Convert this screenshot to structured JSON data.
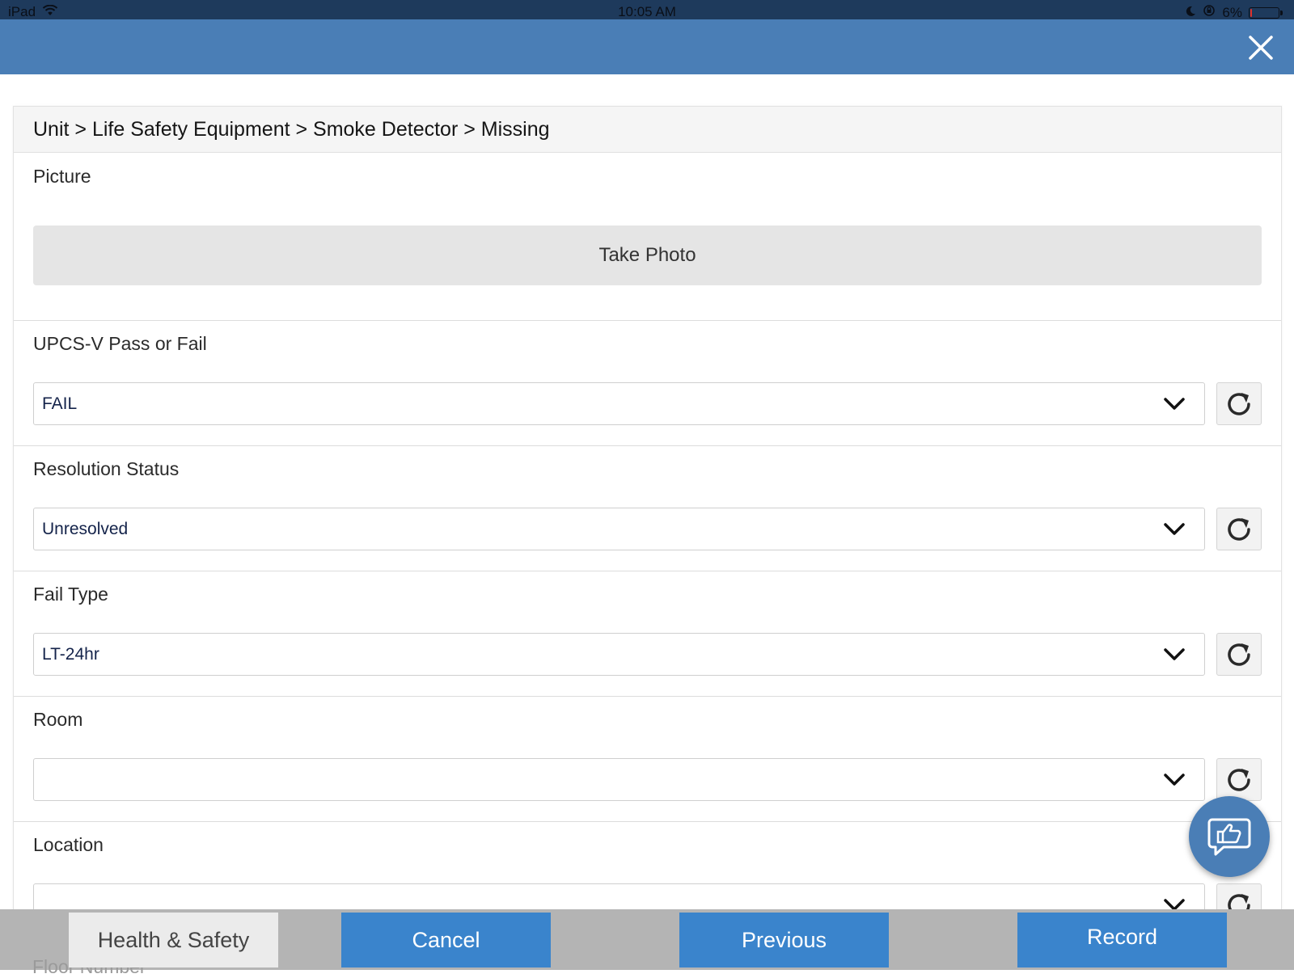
{
  "status_bar": {
    "device": "iPad",
    "time": "10:05 AM",
    "battery_percent": "6%",
    "battery_level": 0.06
  },
  "breadcrumb": "Unit > Life Safety Equipment > Smoke Detector > Missing",
  "picture": {
    "label": "Picture",
    "button_label": "Take Photo"
  },
  "fields": [
    {
      "label": "UPCS-V Pass or Fail",
      "value": "FAIL"
    },
    {
      "label": "Resolution Status",
      "value": "Unresolved"
    },
    {
      "label": "Fail Type",
      "value": "LT-24hr"
    },
    {
      "label": "Room",
      "value": ""
    },
    {
      "label": "Location",
      "value": ""
    }
  ],
  "partially_hidden_label": "Floor Number",
  "footer": {
    "health_safety": "Health & Safety",
    "cancel": "Cancel",
    "previous": "Previous",
    "record": "Record"
  },
  "colors": {
    "header": "#4a7eb6",
    "primary_button": "#3a84cc",
    "status_bar": "#1e3a5c"
  }
}
